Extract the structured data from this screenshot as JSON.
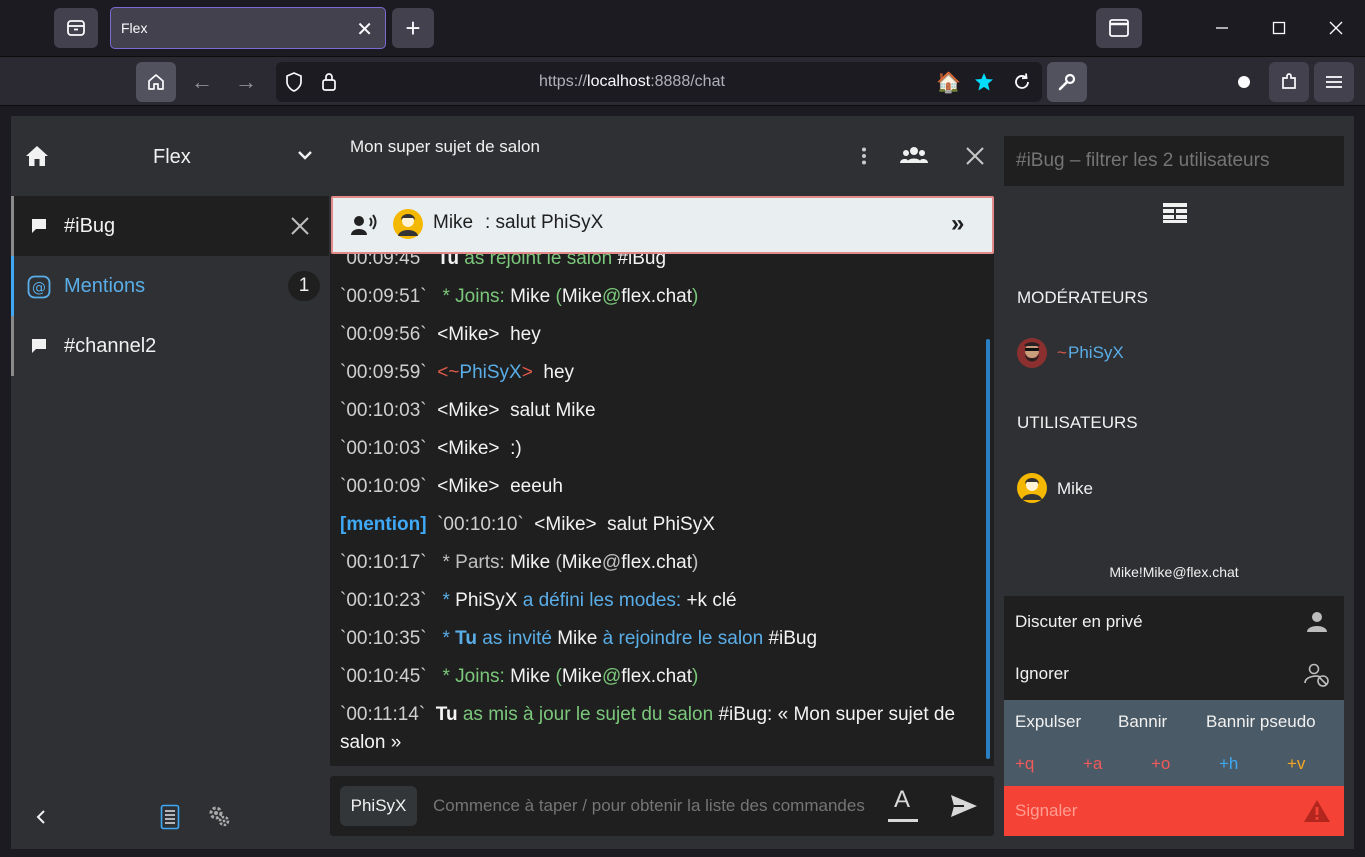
{
  "browser": {
    "tab_title": "Flex",
    "url_prefix": "https://",
    "url_host": "localhost",
    "url_rest": ":8888/chat"
  },
  "sidebar": {
    "network": "Flex",
    "channels": [
      {
        "label": "#iBug"
      },
      {
        "label": "Mentions",
        "badge": "1"
      },
      {
        "label": "#channel2"
      }
    ]
  },
  "chat": {
    "topic": "Mon super sujet de salon",
    "pinned": {
      "nick": "Mike",
      "text": ": salut PhiSyX"
    },
    "messages": {
      "m0": {
        "ts": "`00:09:45`",
        "a": "Tu",
        "b": "as rejoint le salon",
        "c": "#iBug"
      },
      "m1": {
        "ts": "`00:09:51`",
        "star": "*",
        "a": "Joins:",
        "b": "Mike",
        "c": "(",
        "d": "Mike",
        "e": "@",
        "f": "flex.chat",
        "g": ")"
      },
      "m2": {
        "ts": "`00:09:56`",
        "nick": "<Mike>",
        "text": "hey"
      },
      "m3": {
        "ts": "`00:09:59`",
        "lt": "<~",
        "nick": "PhiSyX",
        "gt": ">",
        "text": "hey"
      },
      "m4": {
        "ts": "`00:10:03`",
        "nick": "<Mike>",
        "text": "salut Mike"
      },
      "m5": {
        "ts": "`00:10:03`",
        "nick": "<Mike>",
        "text": ":)"
      },
      "m6": {
        "ts": "`00:10:09`",
        "nick": "<Mike>",
        "text": "eeeuh"
      },
      "m7": {
        "tag": "[mention]",
        "ts": "`00:10:10`",
        "nick": "<Mike>",
        "text": "salut PhiSyX"
      },
      "m8": {
        "ts": "`00:10:17`",
        "star": "*",
        "a": "Parts:",
        "b": "Mike",
        "c": "(",
        "d": "Mike",
        "e": "@",
        "f": "flex.chat",
        "g": ")"
      },
      "m9": {
        "ts": "`00:10:23`",
        "star": "*",
        "a": "PhiSyX",
        "b": "a défini les modes:",
        "c": "+k clé"
      },
      "m10": {
        "ts": "`00:10:35`",
        "star": "*",
        "a": "Tu",
        "b": "as invité",
        "c": "Mike",
        "d": "à rejoindre le salon",
        "e": "#iBug"
      },
      "m11": {
        "ts": "`00:10:45`",
        "star": "*",
        "a": "Joins:",
        "b": "Mike",
        "c": "(",
        "d": "Mike",
        "e": "@",
        "f": "flex.chat",
        "g": ")"
      },
      "m12": {
        "ts": "`00:11:14`",
        "a": "Tu",
        "b": "as mis à jour le sujet du salon",
        "c": "#iBug:",
        "d": "« Mon super sujet de",
        "e": "salon »"
      }
    },
    "input": {
      "nick": "PhiSyX",
      "placeholder": "Commence à taper / pour obtenir la liste des commandes"
    }
  },
  "userlist": {
    "filter_placeholder": "#iBug – filtrer les 2 utilisateurs",
    "moderators_heading": "MODÉRATEURS",
    "moderator": {
      "prefix": "~",
      "nick": "PhiSyX"
    },
    "users_heading": "UTILISATEURS",
    "user": {
      "nick": "Mike"
    },
    "selected_hostmask": "Mike!Mike@flex.chat",
    "actions": {
      "private": "Discuter en privé",
      "ignore": "Ignorer",
      "kick": "Expulser",
      "ban": "Bannir",
      "ban_nick": "Bannir pseudo",
      "modes": [
        "+q",
        "+a",
        "+o",
        "+h",
        "+v"
      ],
      "report": "Signaler"
    }
  },
  "colors": {
    "accent": "#5aaee8",
    "join": "#7bc77b",
    "danger": "#f44336",
    "mode_q": "#f05a5a",
    "mode_h": "#3fa9f5",
    "mode_v": "#f5a623"
  }
}
